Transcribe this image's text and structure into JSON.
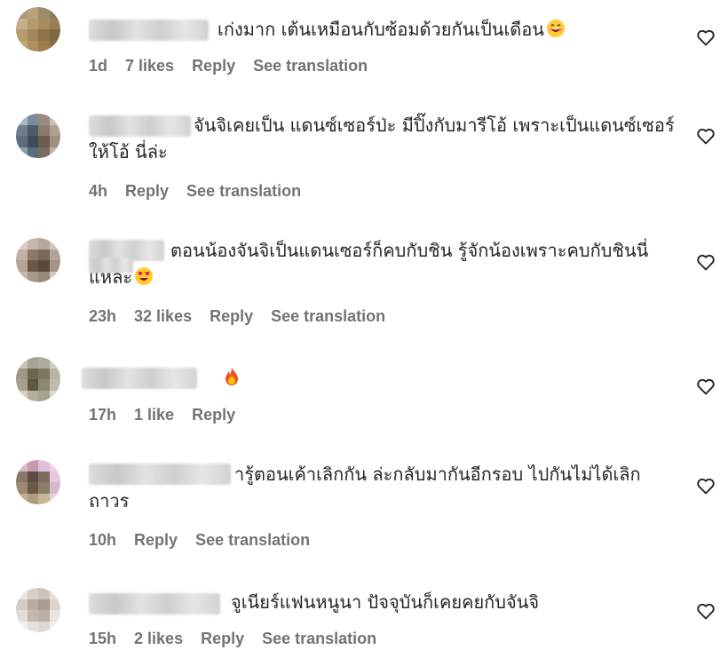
{
  "comments": [
    {
      "text": "เก่งมาก เต้นเหมือนกับซ้อมด้วยกันเป็นเดือน",
      "emoji": "grinning-face-emoji",
      "time": "1d",
      "likes": "7 likes",
      "reply": "Reply",
      "translate": "See translation",
      "avatar_colors": [
        "#a89a7a",
        "#b8a27a",
        "#9c8c6c",
        "#8c7c5c",
        "#c4b08a",
        "#b59a6a",
        "#a88c5c",
        "#9a8050",
        "#b89c6c",
        "#a08858",
        "#8c7448",
        "#7c6a42",
        "#c4a470",
        "#b09060",
        "#9c7c4c",
        "#8a6c40"
      ]
    },
    {
      "text": "จันจิเคยเป็น แดนซ์เซอร์ป่ะ มีปิ๊งกับมารีโอ้ เพราะเป็นแดนซ์เซอร์ให้โอ้ นี่ล่ะ",
      "time": "4h",
      "reply": "Reply",
      "translate": "See translation",
      "avatar_colors": [
        "#a8b8c8",
        "#7c8c9c",
        "#9c8c7c",
        "#c8c0b0",
        "#6c7c8c",
        "#4c5c6c",
        "#8c7c6c",
        "#b0a090",
        "#5c6c7c",
        "#3c4c5c",
        "#6c5c4c",
        "#a09080",
        "#8c9cac",
        "#5c6c7c",
        "#7c6c5c",
        "#c0b0a0"
      ]
    },
    {
      "text": "ตอนน้องจันจิเป็นแดนเซอร์ก็คบกับชิน รู้จักน้องเพราะคบกับชินนี่แหละ",
      "emoji": "heart-eyes-emoji",
      "time": "23h",
      "likes": "32 likes",
      "reply": "Reply",
      "translate": "See translation",
      "avatar_colors": [
        "#d8ccc4",
        "#c8b8ac",
        "#b8a89c",
        "#d0c4bc",
        "#c0b0a4",
        "#8c7868",
        "#7c6858",
        "#b4a498",
        "#b4a498",
        "#6c5848",
        "#5c4838",
        "#a49488",
        "#c4b8b0",
        "#a89888",
        "#988878",
        "#d4c8c0"
      ]
    },
    {
      "text": "",
      "emoji": "fire-emoji",
      "time": "17h",
      "likes": "1 like",
      "reply": "Reply",
      "avatar_colors": [
        "#c8c4b8",
        "#a8a494",
        "#b0ac9c",
        "#d0ccc0",
        "#9c9884",
        "#6c6850",
        "#7c7860",
        "#b8b4a4",
        "#a4a08c",
        "#5c5840",
        "#8c8870",
        "#c0bcac",
        "#d4d0c4",
        "#b4b0a0",
        "#a8a494",
        "#dcd8cc"
      ]
    },
    {
      "text": "ารู้ตอนเค้าเลิกกัน ล่ะกลับมากันอีกรอบ ไปกันไม่ได้เลิกถาวร",
      "time": "10h",
      "reply": "Reply",
      "translate": "See translation",
      "avatar_colors": [
        "#d8b8c8",
        "#c898b0",
        "#e0c0d8",
        "#f0d0e8",
        "#8c7868",
        "#5c4c44",
        "#7c6c60",
        "#e8c8dc",
        "#a08870",
        "#6c5848",
        "#8c7c6c",
        "#d8b8cc",
        "#c4b08c",
        "#b09c7c",
        "#c8b898",
        "#e4d0dc"
      ]
    },
    {
      "text": "จูเนียร์แฟนหนูนา ปัจจุบันก็เคยคยกับจันจิ",
      "time": "15h",
      "likes": "2 likes",
      "reply": "Reply",
      "translate": "See translation",
      "avatar_colors": [
        "#e8e4e0",
        "#d8d0c8",
        "#ccc4bc",
        "#e4e0dc",
        "#d4ccc4",
        "#b8aca0",
        "#a89c90",
        "#dcd4cc",
        "#e0dcd8",
        "#c4b8ac",
        "#bcb0a4",
        "#e8e4e0",
        "#f0ece8",
        "#e4e0dc",
        "#dcd8d4",
        "#f4f0ec"
      ]
    }
  ]
}
